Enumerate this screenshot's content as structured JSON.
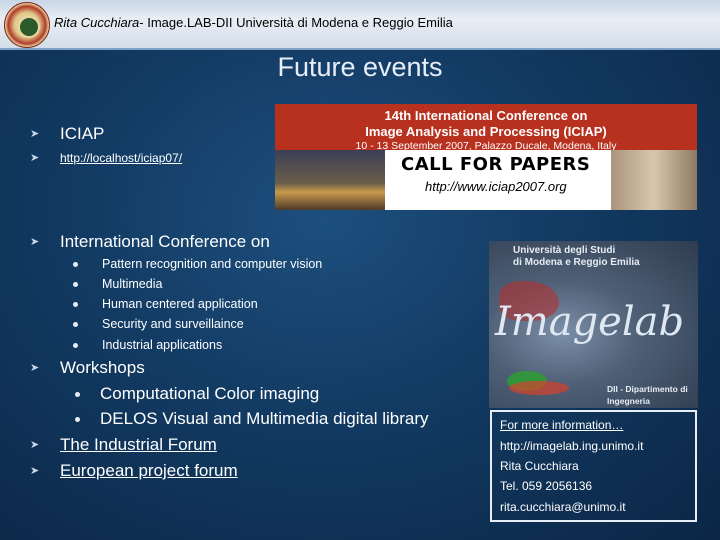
{
  "header": {
    "author": "Rita Cucchiara",
    "affiliation": "- Image.LAB-DII Università di Modena e Reggio Emilia"
  },
  "title": "Future events",
  "bullets": {
    "iciap": "ICIAP",
    "iciap_url": "http://localhost/iciap07/",
    "intl_conf": "International Conference on",
    "topics": [
      "Pattern recognition and computer vision",
      "Multimedia",
      "Human centered application",
      "Security and surveillaince",
      "Industrial applications"
    ],
    "workshops": "Workshops",
    "workshop_items": [
      "Computational Color imaging",
      "DELOS Visual and Multimedia digital library"
    ],
    "industrial_forum": "The Industrial Forum",
    "european_forum": "European project forum"
  },
  "iciap_banner": {
    "title_line1": "14th International Conference on",
    "title_line2": "Image Analysis and Processing (ICIAP)",
    "dates": "10 - 13 September 2007, Palazzo Ducale, Modena, Italy",
    "cfp": "CALL FOR PAPERS",
    "url": "http://www.iciap2007.org"
  },
  "imagelab_picture": {
    "header_line1": "Università degli Studi",
    "header_line2": "di Modena e Reggio Emilia",
    "logo": "Imagelab",
    "footer_line1": "DII - Dipartimento di",
    "footer_line2": "Ingegneria dell'Informazione"
  },
  "info": {
    "more": "For more information…",
    "url": "http://imagelab.ing.unimo.it",
    "name": "Rita Cucchiara",
    "tel": "Tel. 059 2056136",
    "email": "rita.cucchiara@unimo.it"
  }
}
